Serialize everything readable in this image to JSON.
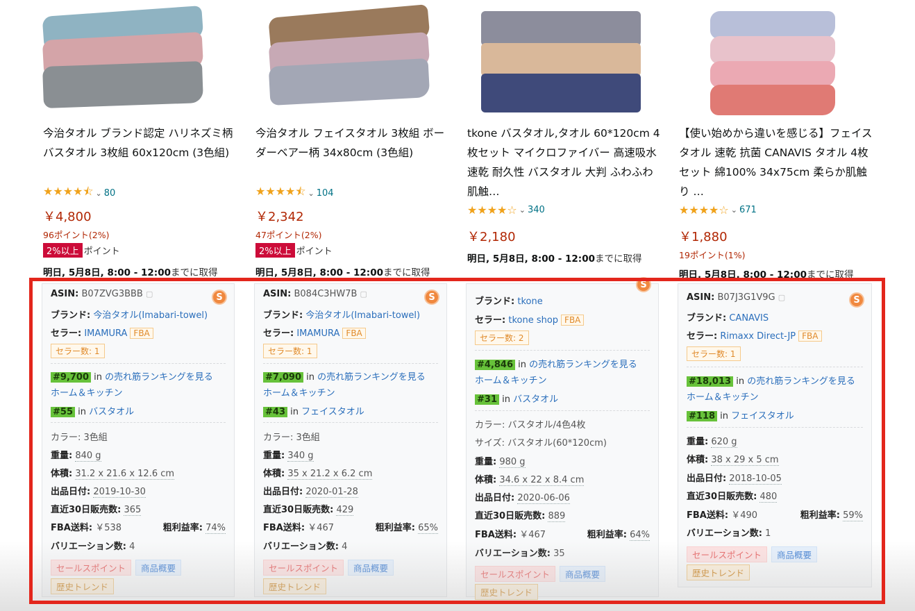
{
  "products": [
    {
      "title": "今治タオル ブランド認定 ハリネズミ柄 バスタオル 3枚組 60x120cm (3色組)",
      "stars": "★★★★⯪",
      "review_count": "80",
      "price": "￥4,800",
      "points": "96ポイント(2%)",
      "badge": "2%以上",
      "badge_suffix": "ポイント",
      "delivery_bold": "明日, 5月8日, 8:00 - 12:00",
      "delivery_rest": "までに取得",
      "info": {
        "asin_label": "ASIN:",
        "asin": "B07ZVG3BBB",
        "brand_label": "ブランド:",
        "brand": "今治タオル(Imabari-towel)",
        "seller_label": "セラー:",
        "seller": "IMAMURA",
        "fba": "FBA",
        "seller_count": "セラー数: 1",
        "rank1": "#9,700",
        "rank1_in": "in",
        "rank1_text": "の売れ筋ランキングを見る",
        "rank1_cat": "ホーム＆キッチン",
        "rank2": "#55",
        "rank2_in": "in",
        "rank2_cat": "バスタオル",
        "color_label": "カラー:",
        "color": "3色組",
        "weight_label": "重量:",
        "weight": "840 g",
        "volume_label": "体積:",
        "volume": "31.2 x 21.6 x 12.6 cm",
        "date_label": "出品日付:",
        "date": "2019-10-30",
        "sales_label": "直近30日販売数:",
        "sales": "365",
        "fba_fee_label": "FBA送料:",
        "fba_fee": "￥538",
        "margin_label": "粗利益率:",
        "margin": "74%",
        "variation_label": "バリエーション数:",
        "variation": "4",
        "tags": [
          "セールスポイント",
          "商品概要",
          "歴史トレンド"
        ]
      }
    },
    {
      "title": "今治タオル フェイスタオル 3枚組 ボーダーベアー柄 34x80cm (3色組)",
      "stars": "★★★★⯪",
      "review_count": "104",
      "price": "￥2,342",
      "points": "47ポイント(2%)",
      "badge": "2%以上",
      "badge_suffix": "ポイント",
      "delivery_bold": "明日, 5月8日, 8:00 - 12:00",
      "delivery_rest": "までに取得",
      "info": {
        "asin_label": "ASIN:",
        "asin": "B084C3HW7B",
        "brand_label": "ブランド:",
        "brand": "今治タオル(Imabari-towel)",
        "seller_label": "セラー:",
        "seller": "IMAMURA",
        "fba": "FBA",
        "seller_count": "セラー数: 1",
        "rank1": "#7,090",
        "rank1_in": "in",
        "rank1_text": "の売れ筋ランキングを見る",
        "rank1_cat": "ホーム＆キッチン",
        "rank2": "#43",
        "rank2_in": "in",
        "rank2_cat": "フェイスタオル",
        "color_label": "カラー:",
        "color": "3色組",
        "weight_label": "重量:",
        "weight": "340 g",
        "volume_label": "体積:",
        "volume": "35 x 21.2 x 6.2 cm",
        "date_label": "出品日付:",
        "date": "2020-01-28",
        "sales_label": "直近30日販売数:",
        "sales": "429",
        "fba_fee_label": "FBA送料:",
        "fba_fee": "￥467",
        "margin_label": "粗利益率:",
        "margin": "65%",
        "variation_label": "バリエーション数:",
        "variation": "4",
        "tags": [
          "セールスポイント",
          "商品概要",
          "歴史トレンド"
        ]
      }
    },
    {
      "title": "tkone バスタオル,タオル 60*120cm 4枚セット マイクロファイバー 高速吸水 速乾 耐久性 バスタオル 大判 ふわふわ 肌触…",
      "stars": "★★★★☆",
      "review_count": "340",
      "price": "￥2,180",
      "delivery_bold": "明日, 5月8日, 8:00 - 12:00",
      "delivery_rest": "までに取得",
      "info": {
        "brand_label": "ブランド:",
        "brand": "tkone",
        "seller_label": "セラー:",
        "seller": "tkone shop",
        "fba": "FBA",
        "seller_count": "セラー数: 2",
        "rank1": "#4,846",
        "rank1_in": "in",
        "rank1_text": "の売れ筋ランキングを見る",
        "rank1_cat": "ホーム＆キッチン",
        "rank2": "#31",
        "rank2_in": "in",
        "rank2_cat": "バスタオル",
        "color_label": "カラー:",
        "color": "バスタオル/4色4枚",
        "size_label": "サイズ:",
        "size": "バスタオル(60*120cm)",
        "weight_label": "重量:",
        "weight": "980 g",
        "volume_label": "体積:",
        "volume": "34.6 x 22 x 8.4 cm",
        "date_label": "出品日付:",
        "date": "2020-06-06",
        "sales_label": "直近30日販売数:",
        "sales": "889",
        "fba_fee_label": "FBA送料:",
        "fba_fee": "￥467",
        "margin_label": "粗利益率:",
        "margin": "64%",
        "variation_label": "バリエーション数:",
        "variation": "35",
        "tags": [
          "セールスポイント",
          "商品概要",
          "歴史トレンド"
        ]
      }
    },
    {
      "title": "【使い始めから違いを感じる】フェイスタオル 速乾 抗菌 CANAVIS タオル 4枚セット 綿100% 34x75cm 柔らか肌触り …",
      "stars": "★★★★☆",
      "review_count": "671",
      "price": "￥1,880",
      "points": "19ポイント(1%)",
      "delivery_bold": "明日, 5月8日, 8:00 - 12:00",
      "delivery_rest": "までに取得",
      "info": {
        "asin_label": "ASIN:",
        "asin": "B07J3G1V9G",
        "brand_label": "ブランド:",
        "brand": "CANAVIS",
        "seller_label": "セラー:",
        "seller": "Rimaxx Direct-JP",
        "fba": "FBA",
        "seller_count": "セラー数: 1",
        "rank1": "#18,013",
        "rank1_in": "in",
        "rank1_text": "の売れ筋ランキングを見る",
        "rank1_cat": "ホーム＆キッチン",
        "rank2": "#118",
        "rank2_in": "in",
        "rank2_cat": "フェイスタオル",
        "weight_label": "重量:",
        "weight": "620 g",
        "volume_label": "体積:",
        "volume": "38 x 29 x 5 cm",
        "date_label": "出品日付:",
        "date": "2018-10-05",
        "sales_label": "直近30日販売数:",
        "sales": "480",
        "fba_fee_label": "FBA送料:",
        "fba_fee": "￥490",
        "margin_label": "粗利益率:",
        "margin": "59%",
        "variation_label": "バリエーション数:",
        "variation": "1",
        "tags": [
          "セールスポイント",
          "商品概要",
          "歴史トレンド"
        ]
      }
    }
  ],
  "ext_icon_letter": "S",
  "copy_icon": "copy-icon",
  "colors": {
    "accent": "#e3261c",
    "rank": "#67c23a",
    "link": "#2a6ebb",
    "price": "#b12704",
    "star": "#f0a21b"
  }
}
